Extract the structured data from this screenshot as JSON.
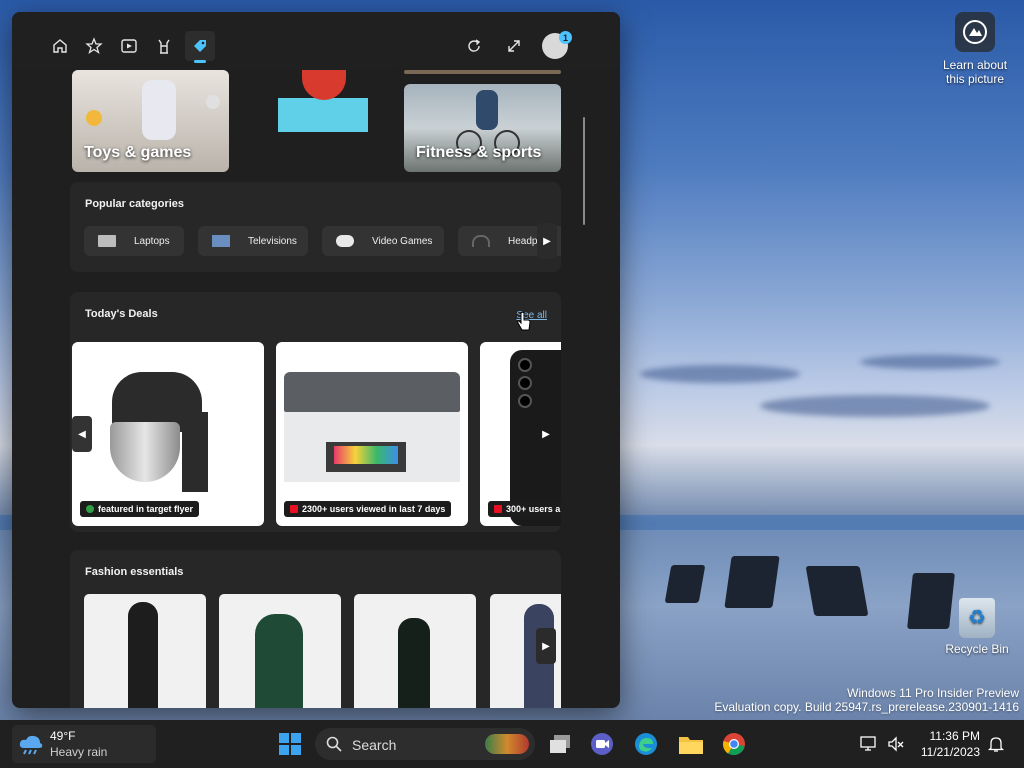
{
  "panel": {
    "nav": [
      "home-icon",
      "favorites-icon",
      "video-icon",
      "games-icon",
      "shopping-icon"
    ],
    "account_badge": "1",
    "tiles": {
      "toys_label": "Toys & games",
      "fitness_label": "Fitness & sports"
    },
    "popular": {
      "title": "Popular categories",
      "chips": [
        "Laptops",
        "Televisions",
        "Video Games",
        "Headph"
      ]
    },
    "deals": {
      "title": "Today's Deals",
      "see_all": "See all",
      "items": [
        {
          "badge": "featured in target flyer",
          "badge_color": "#2ea043"
        },
        {
          "badge": "2300+ users viewed in last 7 days",
          "badge_color": "#e81123"
        },
        {
          "badge": "300+ users a",
          "badge_color": "#e81123"
        }
      ]
    },
    "fashion": {
      "title": "Fashion essentials"
    }
  },
  "desktop": {
    "learn_line1": "Learn about",
    "learn_line2": "this picture",
    "recycle": "Recycle Bin",
    "watermark_line1": "Windows 11 Pro Insider Preview",
    "watermark_line2": "Evaluation copy. Build 25947.rs_prerelease.230901-1416"
  },
  "taskbar": {
    "weather_temp": "49°F",
    "weather_desc": "Heavy rain",
    "search_label": "Search",
    "time": "11:36 PM",
    "date": "11/21/2023"
  },
  "colors": {
    "accent": "#4cc2ff",
    "panel_bg": "#1f1f1f",
    "card_bg": "#272727"
  }
}
